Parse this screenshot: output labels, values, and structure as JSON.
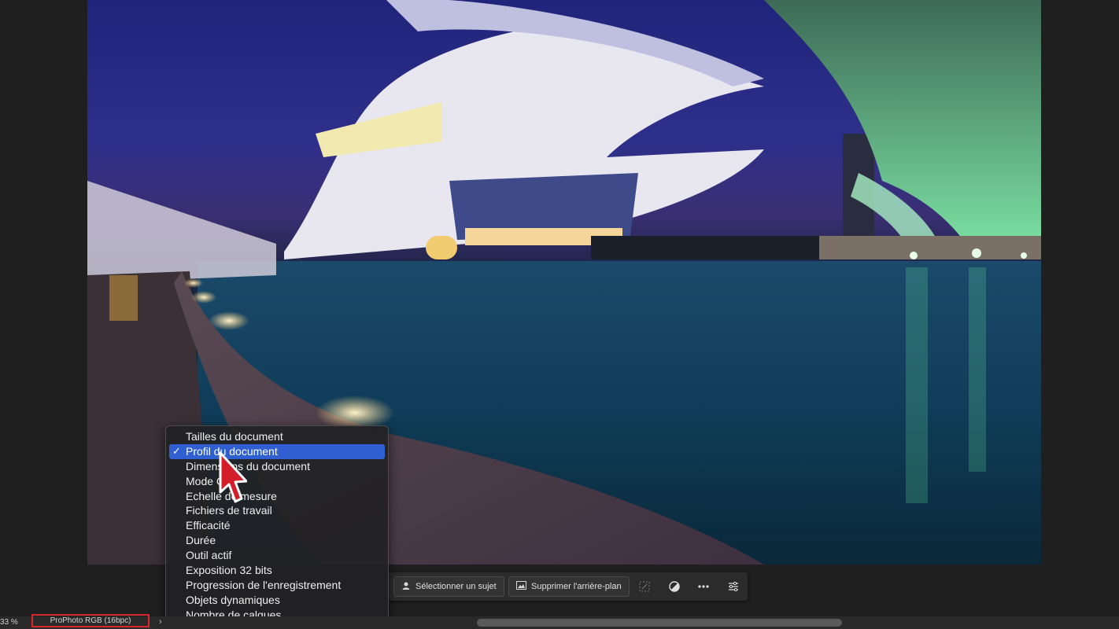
{
  "statusbar": {
    "zoom": "33 %",
    "profile": "ProPhoto RGB (16bpc)",
    "chevron": "›"
  },
  "taskbar": {
    "select_subject": "Sélectionner un sujet",
    "remove_background": "Supprimer l'arrière-plan",
    "icons": [
      "transform-icon",
      "mask-icon",
      "more-icon",
      "properties-icon"
    ]
  },
  "menu": {
    "selected_index": 1,
    "check": "✓",
    "items": [
      "Tailles du document",
      "Profil du document",
      "Dimensions du document",
      "Mode G",
      "Echelle de mesure",
      "Fichiers de travail",
      "Efficacité",
      "Durée",
      "Outil actif",
      "Exposition 32 bits",
      "Progression de l'enregistrement",
      "Objets dynamiques",
      "Nombre de calques"
    ]
  },
  "colors": {
    "highlight": "#2f5fd1",
    "annotation_box": "#d7262c"
  }
}
